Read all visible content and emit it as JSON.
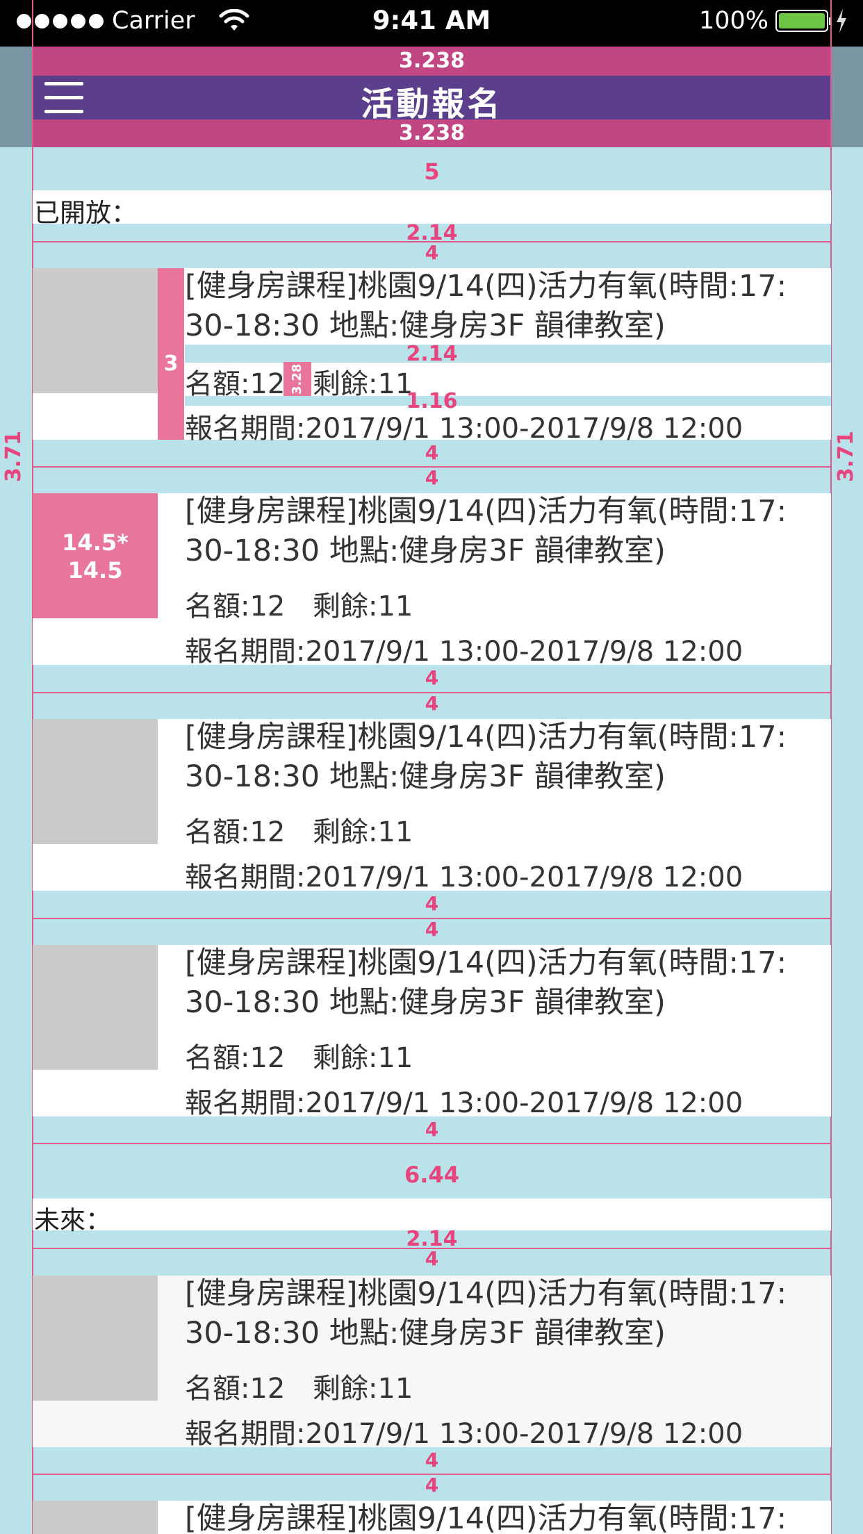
{
  "status_bar": {
    "carrier": "Carrier",
    "time": "9:41 AM",
    "battery_percent": "100%",
    "battery_level": 1.0
  },
  "nav": {
    "title": "活動報名",
    "top_band_value": "3.238",
    "bottom_band_value": "3.238"
  },
  "side_measure": "3.71",
  "sections": {
    "open": {
      "label": "已開放：",
      "spacing_above": "5",
      "spacing_below": "2.14"
    },
    "future": {
      "label": "未來：",
      "spacing_above": "6.44",
      "spacing_below": "2.14"
    }
  },
  "event": {
    "title_line1": "[健身房課程]桃園9/14(四)活力有氧(時間:17:",
    "title_line2": "30-18:30 地點:健身房3F 韻律教室)",
    "quota": "名額:12",
    "remaining": "剩餘:11",
    "period": "報名期間:2017/9/1 13:00-2017/9/8 12:00"
  },
  "annotations": {
    "item_gap": "4",
    "title_meta_gap": "2.14",
    "meta_period_gap": "1.16",
    "left_column": "3",
    "inline_gap": "3.28",
    "thumb_size_line1": "14.5*",
    "thumb_size_line2": "14.5"
  },
  "colors": {
    "background": "#b9e2ea",
    "nav": "#5b3f8c",
    "band": "#c24584",
    "annotation": "#e8447d",
    "thumb": "#cbcbcb"
  }
}
